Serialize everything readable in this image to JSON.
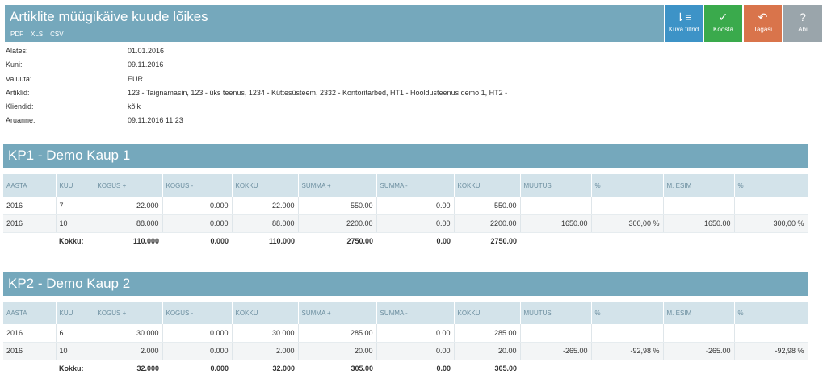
{
  "header": {
    "title": "Artiklite müügikäive kuude lõikes",
    "exports": [
      "PDF",
      "XLS",
      "CSV"
    ]
  },
  "toolbar": [
    {
      "name": "filter-button",
      "icon_name": "filter-list-icon",
      "glyph": "⇂≡",
      "label": "Kuva filtrid",
      "color": "#3d93c7"
    },
    {
      "name": "koosta-button",
      "icon_name": "check-circle-icon",
      "glyph": "✓",
      "label": "Koosta",
      "color": "#3aaa4c"
    },
    {
      "name": "tagasi-button",
      "icon_name": "reply-icon",
      "glyph": "↶",
      "label": "Tagasi",
      "color": "#d9744b"
    },
    {
      "name": "abi-button",
      "icon_name": "help-icon",
      "glyph": "?",
      "label": "Abi",
      "color": "#9aa5ab"
    }
  ],
  "meta": [
    {
      "k": "Alates:",
      "v": "01.01.2016"
    },
    {
      "k": "Kuni:",
      "v": "09.11.2016"
    },
    {
      "k": "Valuuta:",
      "v": "EUR"
    },
    {
      "k": "Artiklid:",
      "v": "123 - Taignamasin, 123 - üks teenus, 1234 - Küttesüsteem, 2332 - Kontoritarbed, HT1 - Hooldusteenus demo 1, HT2 -"
    },
    {
      "k": "Kliendid:",
      "v": "kõik"
    },
    {
      "k": "Aruanne:",
      "v": "09.11.2016 11:23"
    }
  ],
  "columns": [
    "AASTA",
    "KUU",
    "KOGUS +",
    "KOGUS -",
    "KOKKU",
    "SUMMA +",
    "SUMMA -",
    "KOKKU",
    "MUUTUS",
    "%",
    "M. ESIM",
    "%"
  ],
  "sections": [
    {
      "title": "KP1 - Demo Kaup 1",
      "rows": [
        [
          "2016",
          "7",
          "22.000",
          "0.000",
          "22.000",
          "550.00",
          "0.00",
          "550.00",
          "",
          "",
          "",
          ""
        ],
        [
          "2016",
          "10",
          "88.000",
          "0.000",
          "88.000",
          "2200.00",
          "0.00",
          "2200.00",
          "1650.00",
          "300,00 %",
          "1650.00",
          "300,00 %"
        ]
      ],
      "total": [
        "",
        "Kokku:",
        "110.000",
        "0.000",
        "110.000",
        "2750.00",
        "0.00",
        "2750.00",
        "",
        "",
        "",
        ""
      ]
    },
    {
      "title": "KP2 - Demo Kaup 2",
      "rows": [
        [
          "2016",
          "6",
          "30.000",
          "0.000",
          "30.000",
          "285.00",
          "0.00",
          "285.00",
          "",
          "",
          "",
          ""
        ],
        [
          "2016",
          "10",
          "2.000",
          "0.000",
          "2.000",
          "20.00",
          "0.00",
          "20.00",
          "-265.00",
          "-92,98 %",
          "-265.00",
          "-92,98 %"
        ]
      ],
      "total": [
        "",
        "Kokku:",
        "32.000",
        "0.000",
        "32.000",
        "305.00",
        "0.00",
        "305.00",
        "",
        "",
        "",
        ""
      ]
    }
  ]
}
